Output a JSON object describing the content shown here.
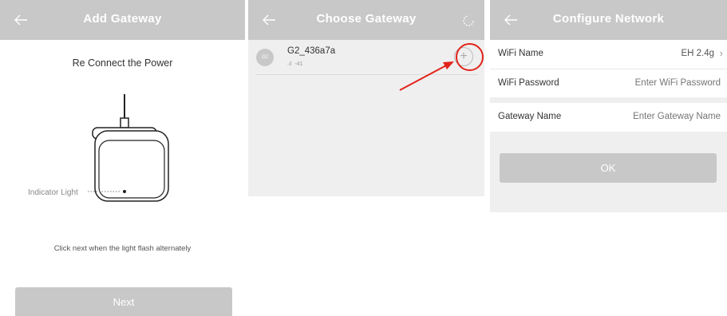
{
  "colors": {
    "header": "#c8c8c8",
    "accent_red": "#e2231a",
    "button_disabled": "#c8c8c8",
    "panel_gray": "#efefef"
  },
  "add_gateway": {
    "title": "Add Gateway",
    "back_icon": "arrow-left-icon",
    "instruction": "Re Connect the Power",
    "indicator_label": "Indicator Light",
    "hint": "Click next when the light flash alternately",
    "next_label": "Next"
  },
  "choose_gateway": {
    "title": "Choose Gateway",
    "back_icon": "arrow-left-icon",
    "refresh_icon": "refresh-icon",
    "gateways": [
      {
        "badge": "G2",
        "name": "G2_436a7a",
        "signal": "-41",
        "add_icon": "plus-icon"
      }
    ]
  },
  "configure_network": {
    "title": "Configure Network",
    "back_icon": "arrow-left-icon",
    "wifi_name_label": "WiFi Name",
    "wifi_name_value": "EH 2.4g",
    "wifi_password_label": "WiFi Password",
    "wifi_password_placeholder": "Enter WiFi Password",
    "gateway_name_label": "Gateway Name",
    "gateway_name_placeholder": "Enter Gateway Name",
    "ok_label": "OK"
  }
}
